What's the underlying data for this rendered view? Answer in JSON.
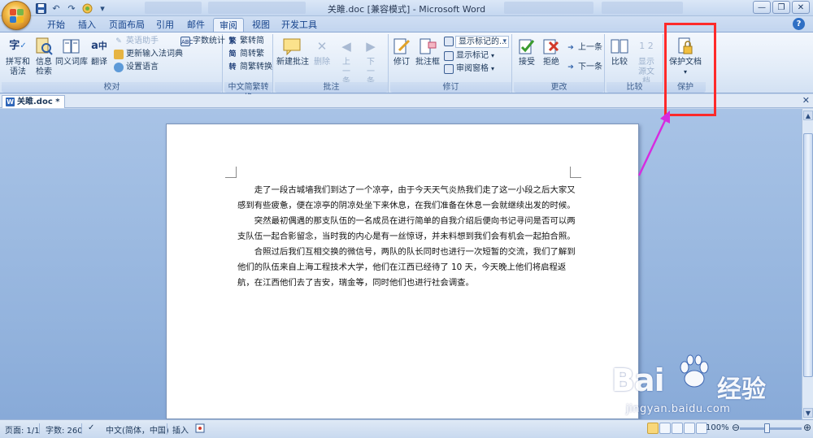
{
  "window": {
    "title": "关雎.doc [兼容模式] - Microsoft Word"
  },
  "quick_access": [
    "save-icon",
    "undo-icon",
    "redo-icon",
    "print-preview-icon"
  ],
  "tabs": [
    {
      "label": "开始"
    },
    {
      "label": "插入"
    },
    {
      "label": "页面布局"
    },
    {
      "label": "引用"
    },
    {
      "label": "邮件"
    },
    {
      "label": "审阅"
    },
    {
      "label": "视图"
    },
    {
      "label": "开发工具"
    }
  ],
  "ribbon": {
    "proofing": {
      "label": "校对",
      "spelling": "拼写和语法",
      "research": "信息检索",
      "thesaurus": "同义词库",
      "translate": "翻译",
      "translate_tip": "英语助手",
      "update_ime": "更新输入法词典",
      "set_language": "设置语言",
      "word_count": "字数统计"
    },
    "chinese": {
      "label": "中文简繁转换",
      "to_simplified": "繁转简",
      "to_traditional": "简转繁",
      "convert": "简繁转换"
    },
    "comments": {
      "label": "批注",
      "new": "新建批注",
      "delete": "删除",
      "prev": "上一条",
      "next": "下一条"
    },
    "tracking": {
      "label": "修订",
      "track": "修订",
      "balloons": "批注框",
      "display_mode": "显示标记的...",
      "show_markup": "显示标记",
      "review_pane": "审阅窗格"
    },
    "changes": {
      "label": "更改",
      "accept": "接受",
      "reject": "拒绝",
      "prev": "上一条",
      "next": "下一条"
    },
    "compare": {
      "label": "比较",
      "compare": "比较",
      "show_source": "显示源文档"
    },
    "protect": {
      "label": "保护",
      "protect_doc": "保护文档"
    }
  },
  "document_tab": {
    "name": "关雎.doc *"
  },
  "document": {
    "paragraphs": [
      "走了一段古城墙我们到达了一个凉亭，由于今天天气炎热我们走了这一小段之后大家又感到有些疲惫，便在凉亭的阴凉处坐下来休息，在我们准备在休息一会就继续出发的时候。",
      "突然最初偶遇的那支队伍的一名成员在进行简单的自我介绍后便向书记寻问是否可以两支队伍一起合影留念，当时我的内心是有一丝惊讶，并未料想到我们会有机会一起拍合照。",
      "合照过后我们互相交换的微信号，两队的队长同时也进行一次短暂的交流，我们了解到他们的队伍来自上海工程技术大学，他们在江西已经待了 10 天，今天晚上他们将启程返航，在江西他们去了吉安，瑞金等，同时他们也进行社会调查。"
    ]
  },
  "status": {
    "page": "页面: 1/1",
    "words": "字数: 260",
    "language": "中文(简体，中国)",
    "mode": "插入",
    "zoom": "100%"
  },
  "watermark": {
    "brand": "Bai",
    "brand_cn": "经验",
    "url": "jingyan.baidu.com"
  },
  "colors": {
    "highlight": "#ff2a2a",
    "arrow": "#d62ce0"
  }
}
